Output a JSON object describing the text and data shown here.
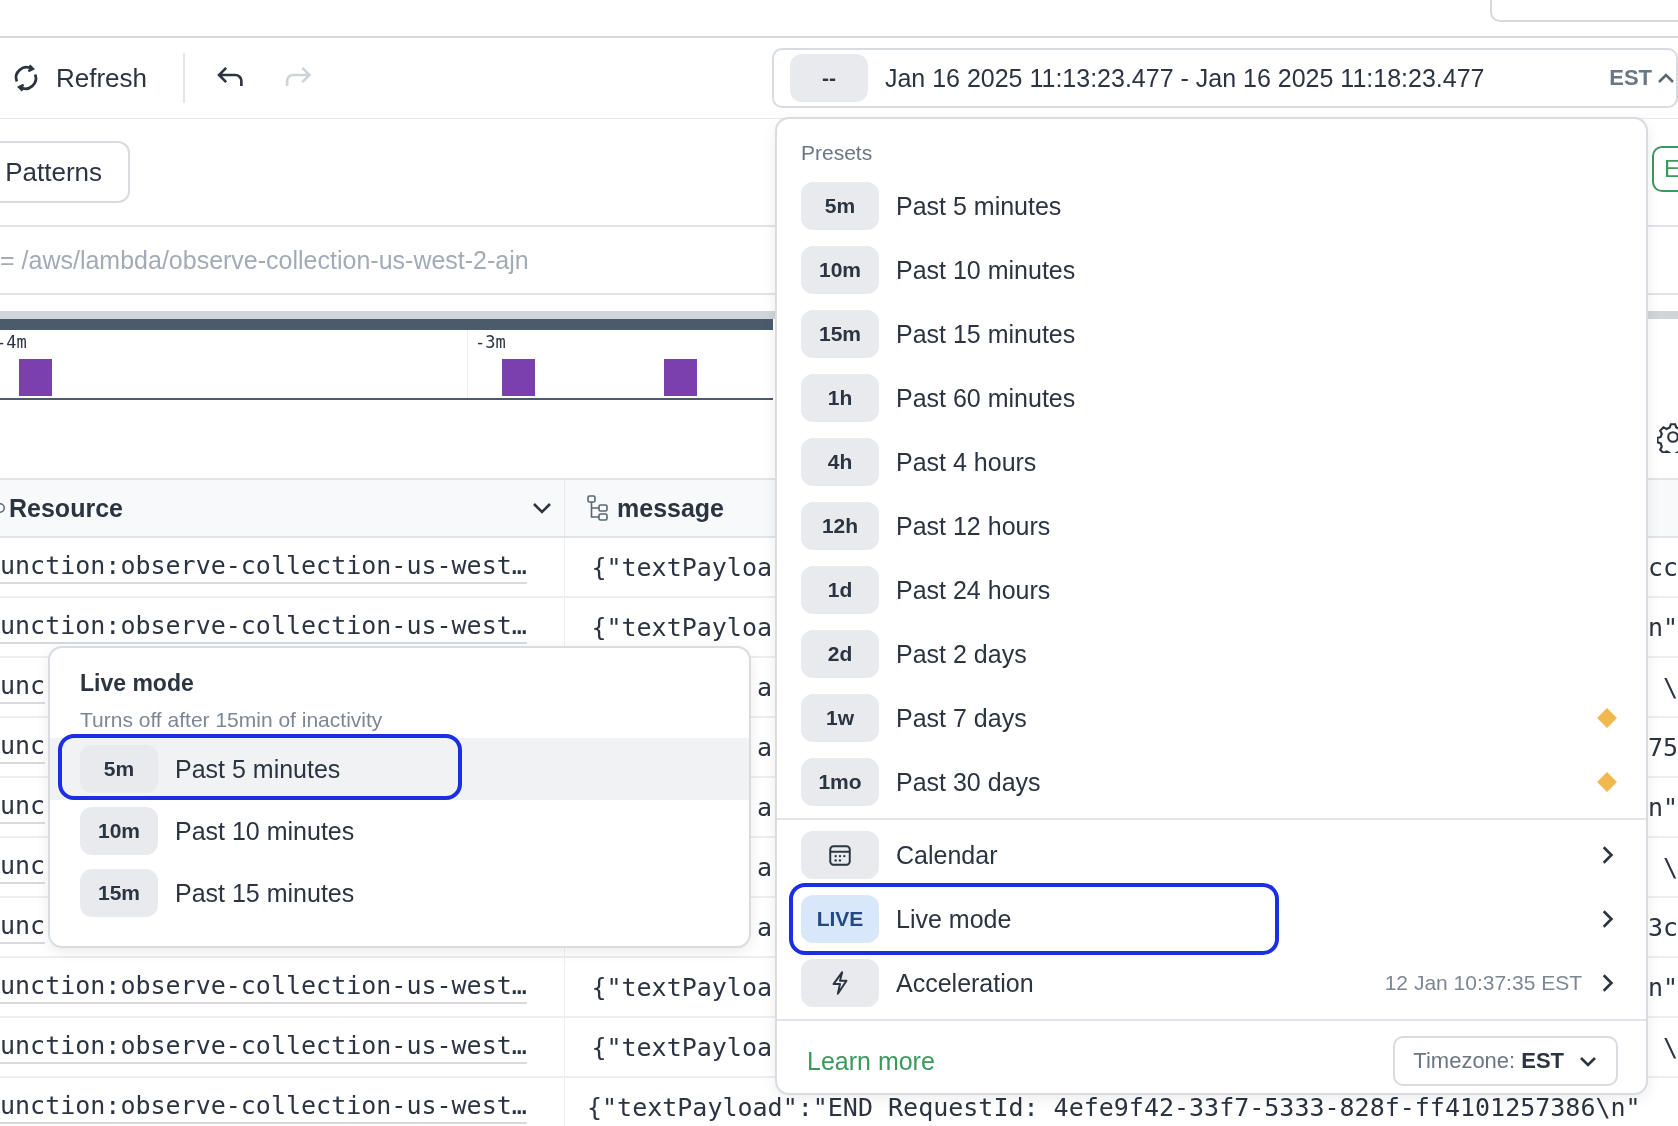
{
  "toolbar": {
    "refresh": "Refresh",
    "undo_disabled": false,
    "redo_disabled": true
  },
  "time_range": {
    "preset": "--",
    "range": "Jan 16 2025 11:13:23.477 - Jan 16 2025 11:18:23.477",
    "timezone": "EST",
    "expanded": true
  },
  "patterns_button": "Patterns",
  "filter": {
    "query": "= /aws/lambda/observe-collection-us-west-2-ajn"
  },
  "side_button": "E",
  "chart": {
    "ticks": [
      "-4m",
      "-3m"
    ]
  },
  "table": {
    "columns": [
      {
        "label": "Resource",
        "kind": "dropdown"
      },
      {
        "label": "message",
        "kind": "tree"
      }
    ],
    "rows": [
      {
        "kind": "partial",
        "resource": "unction:observe-collection-us-west…",
        "message": "{\"textPayloa",
        "tail": "cc"
      },
      {
        "kind": "partial",
        "resource": "unction:observe-collection-us-west…",
        "message": "{\"textPayloa",
        "tail": "n\""
      },
      {
        "kind": "partial",
        "resource": "unc",
        "message": "a",
        "tail": "\\"
      },
      {
        "kind": "partial",
        "resource": "unc",
        "message": "a",
        "tail": "75"
      },
      {
        "kind": "partial",
        "resource": "unc",
        "message": "a",
        "tail": "n\""
      },
      {
        "kind": "partial",
        "resource": "unc",
        "message": "a",
        "tail": "\\"
      },
      {
        "kind": "partial",
        "resource": "unc",
        "message": "a",
        "tail": "3c"
      },
      {
        "kind": "partial",
        "resource": "unction:observe-collection-us-west…",
        "message": "{\"textPayloa",
        "tail": "n\""
      },
      {
        "kind": "partial",
        "resource": "unction:observe-collection-us-west…",
        "message": "{\"textPayloa",
        "tail": "\\"
      },
      {
        "kind": "full",
        "resource": "unction:observe-collection-us-west…",
        "message": "{\"textPayload\":\"END RequestId: 4efe9f42-33f7-5333-828f-ff4101257386\\n\""
      }
    ]
  },
  "presets": {
    "title": "Presets",
    "items": [
      {
        "badge": "5m",
        "label": "Past 5 minutes",
        "premium": false
      },
      {
        "badge": "10m",
        "label": "Past 10 minutes",
        "premium": false
      },
      {
        "badge": "15m",
        "label": "Past 15 minutes",
        "premium": false
      },
      {
        "badge": "1h",
        "label": "Past 60 minutes",
        "premium": false
      },
      {
        "badge": "4h",
        "label": "Past 4 hours",
        "premium": false
      },
      {
        "badge": "12h",
        "label": "Past 12 hours",
        "premium": false
      },
      {
        "badge": "1d",
        "label": "Past 24 hours",
        "premium": false
      },
      {
        "badge": "2d",
        "label": "Past 2 days",
        "premium": false
      },
      {
        "badge": "1w",
        "label": "Past 7 days",
        "premium": true
      },
      {
        "badge": "1mo",
        "label": "Past 30 days",
        "premium": true
      }
    ],
    "extras": [
      {
        "kind": "calendar",
        "label": "Calendar",
        "highlighted": false
      },
      {
        "kind": "live",
        "badge": "LIVE",
        "label": "Live mode",
        "highlighted": true
      },
      {
        "kind": "acceleration",
        "label": "Acceleration",
        "detail": "12 Jan 10:37:35 EST",
        "highlighted": false
      }
    ],
    "footer": {
      "link": "Learn more",
      "timezone_label": "Timezone:",
      "timezone": "EST"
    }
  },
  "live_popup": {
    "title": "Live mode",
    "subtitle": "Turns off after 15min of inactivity",
    "items": [
      {
        "badge": "5m",
        "label": "Past 5 minutes",
        "highlighted": true
      },
      {
        "badge": "10m",
        "label": "Past 10 minutes",
        "highlighted": false
      },
      {
        "badge": "15m",
        "label": "Past 15 minutes",
        "highlighted": false
      }
    ]
  }
}
